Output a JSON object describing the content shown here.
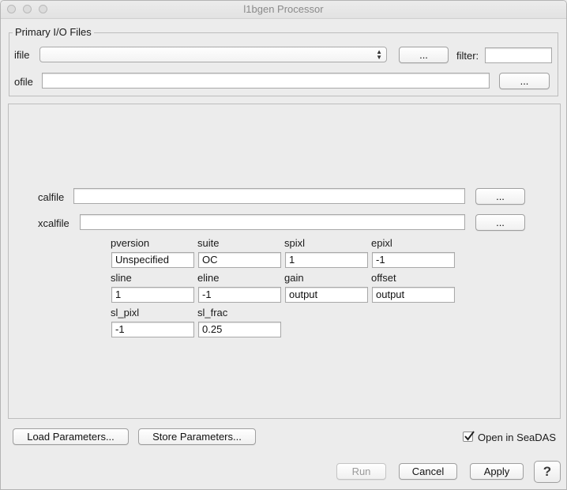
{
  "window": {
    "title": "l1bgen Processor"
  },
  "primary_io": {
    "legend": "Primary I/O Files",
    "ifile_label": "ifile",
    "ifile_value": "",
    "ifile_browse": "...",
    "filter_label": "filter:",
    "filter_value": "",
    "ofile_label": "ofile",
    "ofile_value": "",
    "ofile_browse": "..."
  },
  "params": {
    "calfile_label": "calfile",
    "calfile_value": "",
    "calfile_browse": "...",
    "xcalfile_label": "xcalfile",
    "xcalfile_value": "",
    "xcalfile_browse": "...",
    "fields": [
      {
        "label": "pversion",
        "value": "Unspecified"
      },
      {
        "label": "suite",
        "value": "OC"
      },
      {
        "label": "spixl",
        "value": "1"
      },
      {
        "label": "epixl",
        "value": "-1"
      },
      {
        "label": "sline",
        "value": "1"
      },
      {
        "label": "eline",
        "value": "-1"
      },
      {
        "label": "gain",
        "value": "output"
      },
      {
        "label": "offset",
        "value": "output"
      },
      {
        "label": "sl_pixl",
        "value": "-1"
      },
      {
        "label": "sl_frac",
        "value": "0.25"
      }
    ]
  },
  "bottom": {
    "load_params": "Load Parameters...",
    "store_params": "Store Parameters...",
    "open_in_seadas": "Open in SeaDAS",
    "open_in_seadas_checked": true,
    "run": "Run",
    "cancel": "Cancel",
    "apply": "Apply",
    "help": "?"
  }
}
